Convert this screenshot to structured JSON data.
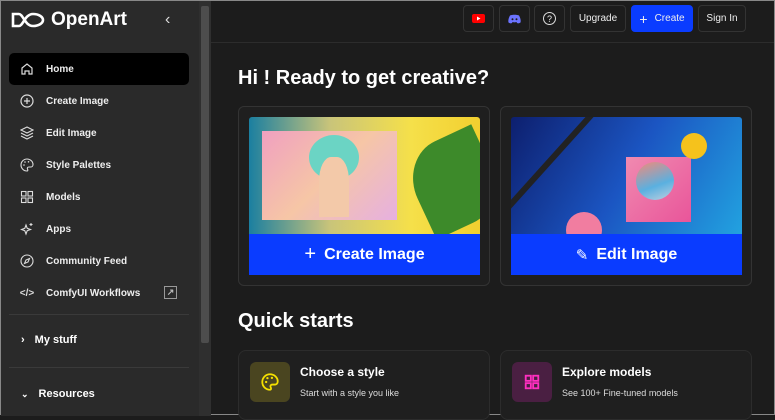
{
  "brand": {
    "name": "OpenArt"
  },
  "sidebar": {
    "items": [
      {
        "label": "Home",
        "icon": "home-icon"
      },
      {
        "label": "Create Image",
        "icon": "plus-circle-icon"
      },
      {
        "label": "Edit Image",
        "icon": "layers-icon"
      },
      {
        "label": "Style Palettes",
        "icon": "palette-icon"
      },
      {
        "label": "Models",
        "icon": "grid-icon"
      },
      {
        "label": "Apps",
        "icon": "sparkles-icon"
      },
      {
        "label": "Community Feed",
        "icon": "compass-icon"
      },
      {
        "label": "ComfyUI Workflows",
        "icon": "code-icon"
      }
    ],
    "my_stuff": "My stuff",
    "resources": "Resources"
  },
  "topbar": {
    "upgrade": "Upgrade",
    "create": "Create",
    "sign_in": "Sign In"
  },
  "main": {
    "greeting": "Hi ! Ready to get creative?",
    "create_image": "Create Image",
    "edit_image": "Edit Image",
    "quick_starts": "Quick starts",
    "quick": [
      {
        "title": "Choose a style",
        "subtitle": "Start with a style you like",
        "color": "#4a4520"
      },
      {
        "title": "Explore models",
        "subtitle": "See 100+ Fine-tuned models",
        "color": "#4a1f42"
      }
    ]
  },
  "colors": {
    "accent": "#0a3cff"
  }
}
